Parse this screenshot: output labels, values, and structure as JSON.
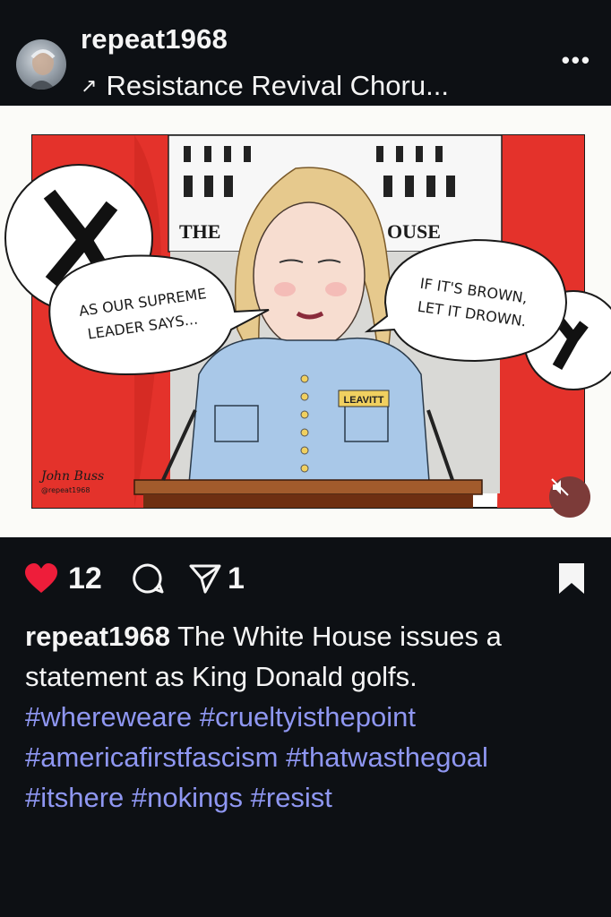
{
  "post": {
    "username": "repeat1968",
    "audio_title": "Resistance Revival Choru...",
    "audio_arrow": "↗",
    "more_icon": "•••"
  },
  "cartoon": {
    "building_label_left": "THE",
    "building_label_right": "OUSE",
    "bubble_left_line1": "AS OUR SUPREME",
    "bubble_left_line2": "LEADER SAYS...",
    "bubble_right_line1": "IF IT'S BROWN,",
    "bubble_right_line2": "LET IT DROWN.",
    "name_tag": "LEAVITT",
    "signature": "John Buss",
    "signature_handle": "@repeat1968"
  },
  "actions": {
    "likes": "12",
    "shares": "1",
    "like_color": "#ee1d3a"
  },
  "caption": {
    "username": "repeat1968",
    "text": "The White House issues a statement as King Donald golfs.",
    "hashtags": "#whereweare #crueltyisthepoint #americafirstfascism #thatwasthegoal #itshere #nokings #resist"
  },
  "colors": {
    "background": "#0d1014",
    "hashtag": "#8f97f2",
    "banner_red": "#e4322b"
  }
}
